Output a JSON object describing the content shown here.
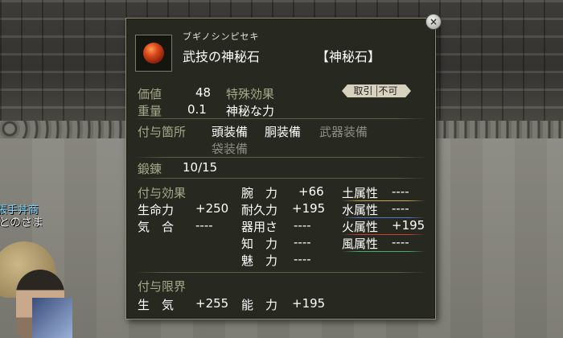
{
  "background": {
    "npc_name": "張手丼商",
    "npc_title": "とのさま"
  },
  "item": {
    "kana": "ブギノシンピセキ",
    "name": "武技の神秘石",
    "category": "【神秘石】",
    "icon": "red-stone-icon"
  },
  "value": {
    "label": "価値",
    "value": "48"
  },
  "weight": {
    "label": "重量",
    "value": "0.1"
  },
  "special": {
    "label": "特殊効果",
    "value": "神秘な力"
  },
  "trade_badge": {
    "left": "取引",
    "right": "不可"
  },
  "attach": {
    "label": "付与箇所",
    "slots": [
      {
        "name": "頭装備",
        "enabled": true
      },
      {
        "name": "胴装備",
        "enabled": true
      },
      {
        "name": "武器装備",
        "enabled": false
      },
      {
        "name": "袋装備",
        "enabled": false
      }
    ]
  },
  "forge": {
    "label": "鍛錬",
    "value": "10/15"
  },
  "effects": {
    "label": "付与効果",
    "left": [
      {
        "label": "生命力",
        "value": "+250"
      },
      {
        "label": "気　合",
        "value": "----"
      }
    ],
    "mid": [
      {
        "label": "腕　力",
        "value": "+66"
      },
      {
        "label": "耐久力",
        "value": "+195"
      },
      {
        "label": "器用さ",
        "value": "----"
      },
      {
        "label": "知　力",
        "value": "----"
      },
      {
        "label": "魅　力",
        "value": "----"
      }
    ],
    "right": [
      {
        "label": "土属性",
        "value": "----",
        "color": "#c9a44a"
      },
      {
        "label": "水属性",
        "value": "----",
        "color": "#4d79c8"
      },
      {
        "label": "火属性",
        "value": "+195",
        "color": "#c8402e"
      },
      {
        "label": "風属性",
        "value": "----",
        "color": "#4aa86a"
      }
    ]
  },
  "limits": {
    "label": "付与限界",
    "items": [
      {
        "label": "生　気",
        "value": "+255"
      },
      {
        "label": "能　力",
        "value": "+195"
      }
    ]
  },
  "close_label": "×"
}
